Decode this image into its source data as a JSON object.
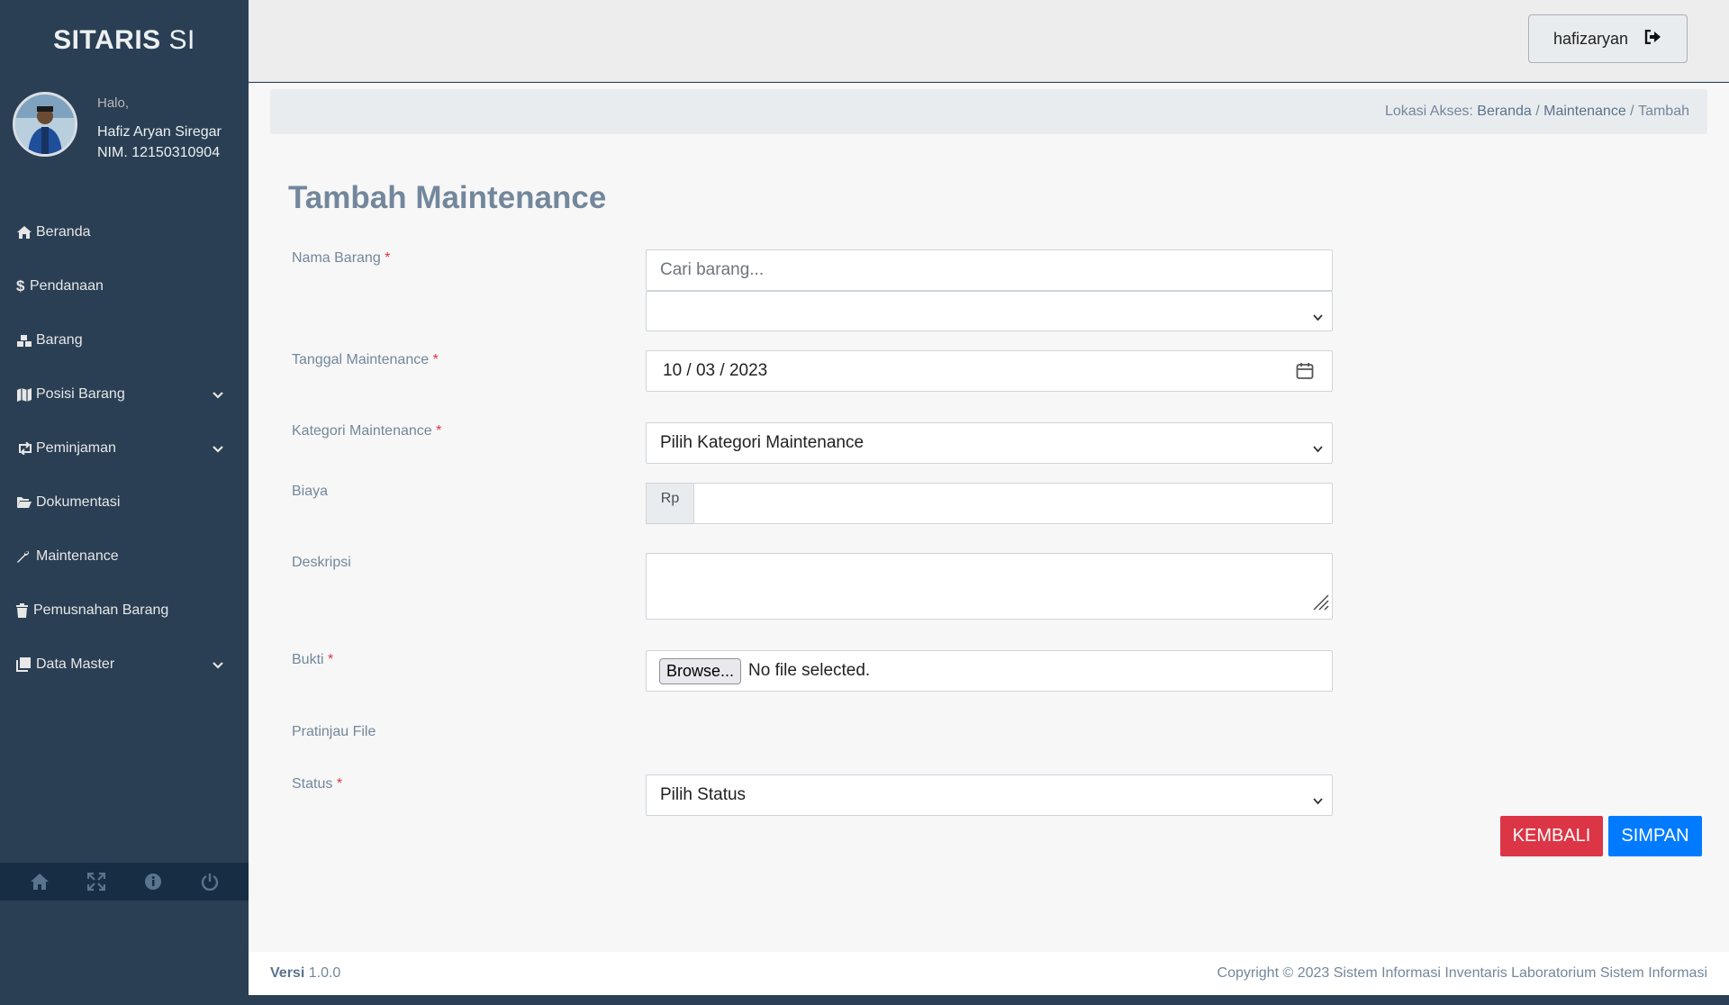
{
  "brand": {
    "bold": "SITARIS",
    "rest": "SI"
  },
  "profile": {
    "greeting": "Halo,",
    "name": "Hafiz Aryan Siregar",
    "nim": "NIM. 12150310904"
  },
  "sidebar": {
    "items": [
      {
        "label": "Beranda",
        "icon": "home-icon"
      },
      {
        "label": "Pendanaan",
        "icon": "dollar-icon"
      },
      {
        "label": "Barang",
        "icon": "cubes-icon"
      },
      {
        "label": "Posisi Barang",
        "icon": "map-icon",
        "expandable": true
      },
      {
        "label": "Peminjaman",
        "icon": "retweet-icon",
        "expandable": true
      },
      {
        "label": "Dokumentasi",
        "icon": "folder-open-icon"
      },
      {
        "label": "Maintenance",
        "icon": "wrench-icon"
      },
      {
        "label": "Pemusnahan Barang",
        "icon": "trash-icon"
      },
      {
        "label": "Data Master",
        "icon": "clone-icon",
        "expandable": true
      }
    ],
    "footer_icons": [
      "home-icon",
      "fullscreen-icon",
      "info-icon",
      "power-icon"
    ]
  },
  "topnav": {
    "username": "hafizaryan"
  },
  "breadcrumb": {
    "prefix": "Lokasi Akses: ",
    "items": [
      "Beranda",
      "Maintenance",
      "Tambah"
    ],
    "sep": " / "
  },
  "page": {
    "title": "Tambah Maintenance"
  },
  "form": {
    "nama_barang": {
      "label": "Nama Barang",
      "placeholder": "Cari barang...",
      "select_value": ""
    },
    "tanggal": {
      "label": "Tanggal Maintenance",
      "value": "10 / 03 / 2023"
    },
    "kategori": {
      "label": "Kategori Maintenance",
      "value": "Pilih Kategori Maintenance"
    },
    "biaya": {
      "label": "Biaya",
      "prefix": "Rp",
      "value": ""
    },
    "deskripsi": {
      "label": "Deskripsi",
      "value": ""
    },
    "bukti": {
      "label": "Bukti",
      "browse": "Browse...",
      "file_status": "No file selected."
    },
    "pratinjau": {
      "label": "Pratinjau File"
    },
    "status": {
      "label": "Status",
      "value": "Pilih Status"
    },
    "required_mark": "*"
  },
  "buttons": {
    "back": "KEMBALI",
    "save": "SIMPAN"
  },
  "footer": {
    "version_label": "Versi",
    "version": "1.0.0",
    "copyright": "Copyright © 2023 Sistem Informasi Inventaris Laboratorium Sistem Informasi"
  },
  "colors": {
    "sidebar": "#2a3f54",
    "danger": "#dc3545",
    "primary": "#007bff",
    "muted": "#73879c"
  }
}
